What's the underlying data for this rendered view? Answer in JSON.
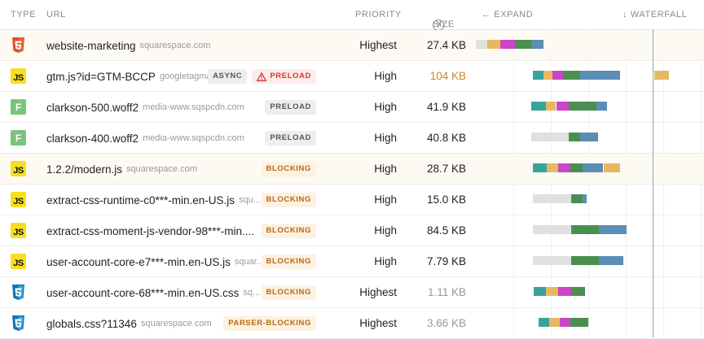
{
  "header": {
    "type": "TYPE",
    "url": "URL",
    "priority": "PRIORITY",
    "size": "SIZE",
    "size_help_glyph": "?",
    "expand": "← EXPAND",
    "waterfall": "↓ WATERFALL"
  },
  "colors": {
    "wait": "#e0e0e0",
    "dns": "#38a39a",
    "connect": "#e8b860",
    "ssl": "#c946c6",
    "ttfb": "#4a8f4f",
    "download": "#5b8db5",
    "marker": "#8ba4c7"
  },
  "rows": [
    {
      "icon": "html",
      "icon_label": "html5-icon",
      "name": "website-marketing",
      "domain": "squarespace.com",
      "badges": [],
      "priority": "Highest",
      "size": "27.4 KB",
      "size_style": "normal",
      "highlight": true,
      "bars": [
        {
          "start": 0.0,
          "end": 13.9,
          "type": "wait"
        },
        {
          "start": 13.9,
          "end": 29.9,
          "type": "connect"
        },
        {
          "start": 29.9,
          "end": 47.7,
          "type": "ssl"
        },
        {
          "start": 47.7,
          "end": 68.4,
          "type": "ttfb"
        },
        {
          "start": 68.4,
          "end": 82.7,
          "type": "download"
        }
      ]
    },
    {
      "icon": "js",
      "icon_label": "js-icon",
      "name": "gtm.js?id=GTM-BCCP",
      "domain": "googletagma...",
      "badges": [
        {
          "text": "ASYNC",
          "style": "async"
        },
        {
          "text": "PRELOAD",
          "style": "preload-warn"
        }
      ],
      "priority": "High",
      "size": "104 KB",
      "size_style": "warn",
      "highlight": false,
      "bars": [
        {
          "start": 69.5,
          "end": 82.7,
          "type": "dns"
        },
        {
          "start": 82.7,
          "end": 94.1,
          "type": "connect"
        },
        {
          "start": 94.1,
          "end": 107.0,
          "type": "ssl"
        },
        {
          "start": 107.0,
          "end": 128.4,
          "type": "ttfb"
        },
        {
          "start": 128.4,
          "end": 176.6,
          "type": "download"
        },
        {
          "start": 219.4,
          "end": 237.3,
          "type": "connect"
        }
      ]
    },
    {
      "icon": "font",
      "icon_label": "font-icon",
      "name": "clarkson-500.woff2",
      "domain": "media-www.sqspcdn.com",
      "badges": [
        {
          "text": "PRELOAD",
          "style": "preload"
        }
      ],
      "priority": "High",
      "size": "41.9 KB",
      "size_style": "normal",
      "highlight": false,
      "bars": [
        {
          "start": 68.4,
          "end": 85.6,
          "type": "dns"
        },
        {
          "start": 85.6,
          "end": 98.5,
          "type": "connect"
        },
        {
          "start": 98.5,
          "end": 114.2,
          "type": "ssl"
        },
        {
          "start": 114.2,
          "end": 148.4,
          "type": "ttfb"
        },
        {
          "start": 148.4,
          "end": 160.9,
          "type": "download"
        }
      ]
    },
    {
      "icon": "font",
      "icon_label": "font-icon",
      "name": "clarkson-400.woff2",
      "domain": "media-www.sqspcdn.com",
      "badges": [
        {
          "text": "PRELOAD",
          "style": "preload"
        }
      ],
      "priority": "High",
      "size": "40.8 KB",
      "size_style": "normal",
      "highlight": false,
      "bars": [
        {
          "start": 68.4,
          "end": 114.2,
          "type": "wait"
        },
        {
          "start": 114.2,
          "end": 128.4,
          "type": "ttfb"
        },
        {
          "start": 128.4,
          "end": 149.8,
          "type": "download"
        }
      ]
    },
    {
      "icon": "js",
      "icon_label": "js-icon",
      "name": "1.2.2/modern.js",
      "domain": "squarespace.com",
      "badges": [
        {
          "text": "BLOCKING",
          "style": "blocking"
        }
      ],
      "priority": "High",
      "size": "28.7 KB",
      "size_style": "normal",
      "highlight": true,
      "bars": [
        {
          "start": 69.5,
          "end": 86.6,
          "type": "dns"
        },
        {
          "start": 86.6,
          "end": 101.3,
          "type": "connect"
        },
        {
          "start": 101.3,
          "end": 115.6,
          "type": "ssl"
        },
        {
          "start": 115.6,
          "end": 131.3,
          "type": "ttfb"
        },
        {
          "start": 131.3,
          "end": 155.6,
          "type": "download"
        },
        {
          "start": 157.0,
          "end": 176.6,
          "type": "connect"
        }
      ]
    },
    {
      "icon": "js",
      "icon_label": "js-icon",
      "name": "extract-css-runtime-c0***-min.en-US.js",
      "domain": "squ...",
      "badges": [
        {
          "text": "BLOCKING",
          "style": "blocking"
        }
      ],
      "priority": "High",
      "size": "15.0 KB",
      "size_style": "normal",
      "highlight": false,
      "bars": [
        {
          "start": 69.5,
          "end": 116.6,
          "type": "wait"
        },
        {
          "start": 116.6,
          "end": 131.3,
          "type": "ttfb"
        },
        {
          "start": 131.3,
          "end": 135.6,
          "type": "download"
        }
      ]
    },
    {
      "icon": "js",
      "icon_label": "js-icon",
      "name": "extract-css-moment-js-vendor-98***-min....",
      "domain": "",
      "badges": [
        {
          "text": "BLOCKING",
          "style": "blocking"
        }
      ],
      "priority": "High",
      "size": "84.5 KB",
      "size_style": "normal",
      "highlight": false,
      "bars": [
        {
          "start": 69.5,
          "end": 116.6,
          "type": "wait"
        },
        {
          "start": 116.6,
          "end": 151.3,
          "type": "ttfb"
        },
        {
          "start": 151.3,
          "end": 185.5,
          "type": "download"
        }
      ]
    },
    {
      "icon": "js",
      "icon_label": "js-icon",
      "name": "user-account-core-e7***-min.en-US.js",
      "domain": "squar...",
      "badges": [
        {
          "text": "BLOCKING",
          "style": "blocking"
        }
      ],
      "priority": "High",
      "size": "7.79 KB",
      "size_style": "normal",
      "highlight": false,
      "bars": [
        {
          "start": 69.5,
          "end": 116.6,
          "type": "wait"
        },
        {
          "start": 116.6,
          "end": 151.3,
          "type": "ttfb"
        },
        {
          "start": 151.3,
          "end": 181.2,
          "type": "download"
        }
      ]
    },
    {
      "icon": "css",
      "icon_label": "css3-icon",
      "name": "user-account-core-68***-min.en-US.css",
      "domain": "sq...",
      "badges": [
        {
          "text": "BLOCKING",
          "style": "blocking"
        }
      ],
      "priority": "Highest",
      "size": "1.11 KB",
      "size_style": "dim",
      "highlight": false,
      "bars": [
        {
          "start": 70.9,
          "end": 85.6,
          "type": "dns"
        },
        {
          "start": 85.6,
          "end": 101.3,
          "type": "connect"
        },
        {
          "start": 101.3,
          "end": 117.0,
          "type": "ssl"
        },
        {
          "start": 117.0,
          "end": 134.1,
          "type": "ttfb"
        }
      ]
    },
    {
      "icon": "css",
      "icon_label": "css3-icon",
      "name": "globals.css?11346",
      "domain": "squarespace.com",
      "badges": [
        {
          "text": "PARSER-BLOCKING",
          "style": "blocking"
        }
      ],
      "priority": "Highest",
      "size": "3.66 KB",
      "size_style": "dim",
      "highlight": false,
      "bars": [
        {
          "start": 77.0,
          "end": 90.0,
          "type": "dns"
        },
        {
          "start": 90.0,
          "end": 103.0,
          "type": "connect"
        },
        {
          "start": 103.0,
          "end": 116.0,
          "type": "ssl"
        },
        {
          "start": 116.0,
          "end": 138.0,
          "type": "ttfb"
        }
      ]
    }
  ]
}
